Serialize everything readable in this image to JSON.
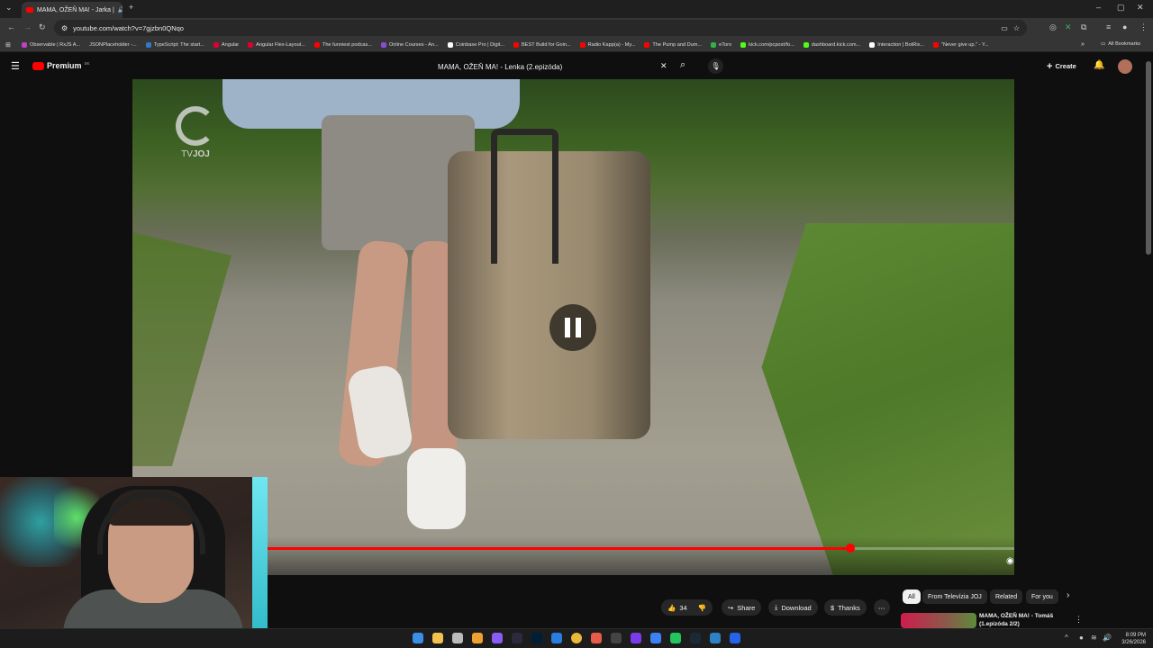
{
  "browser": {
    "tab_title": "MAMA, OŽEŇ MA! - Jarka | ",
    "url": "youtube.com/watch?v=7gjzbn0QNqo",
    "bookmarks": [
      "Observable | RxJS A...",
      "JSONPlaceholder -...",
      "TypeScript: The start...",
      "Angular",
      "Angular Flex-Layout...",
      "The funniest podcas...",
      "Online Courses - An...",
      "Coinbase Pro | Digit...",
      "BEST Build for Goin...",
      "Radio Kapp(a) - My...",
      "The Pump and Dum...",
      "eToro",
      "kick.com/pcpost/fo...",
      "dashboard.kick.com...",
      "Interaction | BotRix...",
      "\"Never give up.\" - Y..."
    ],
    "all_bookmarks_label": "All Bookmarks",
    "colors": {
      "tab_bg": "#353535",
      "toolbar_bg": "#353535",
      "frame_bg": "#1f1f1f"
    }
  },
  "youtube": {
    "logo_text": "Premium",
    "logo_region": "SK",
    "search_value": "MAMA, OŽEŇ MA! - Lenka (2.epizóda)",
    "create_label": "Create",
    "accent": "#ff0000"
  },
  "video": {
    "watermark": "TVJOJ",
    "watermark_tv": "TV",
    "watermark_joj": "JOJ",
    "state": "paused",
    "progress": 0.78
  },
  "actions": {
    "like_count": "34",
    "share_label": "Share",
    "download_label": "Download",
    "thanks_label": "Thanks"
  },
  "chips": [
    "All",
    "From Televízia JOJ",
    "Related",
    "For you"
  ],
  "up_next": {
    "title": "MAMA, OŽEŇ MA! - Tomáš",
    "subtitle": "(1.epizóda 2/2)"
  },
  "taskbar": {
    "time": "8:09 PM",
    "date": "3/26/2026"
  }
}
